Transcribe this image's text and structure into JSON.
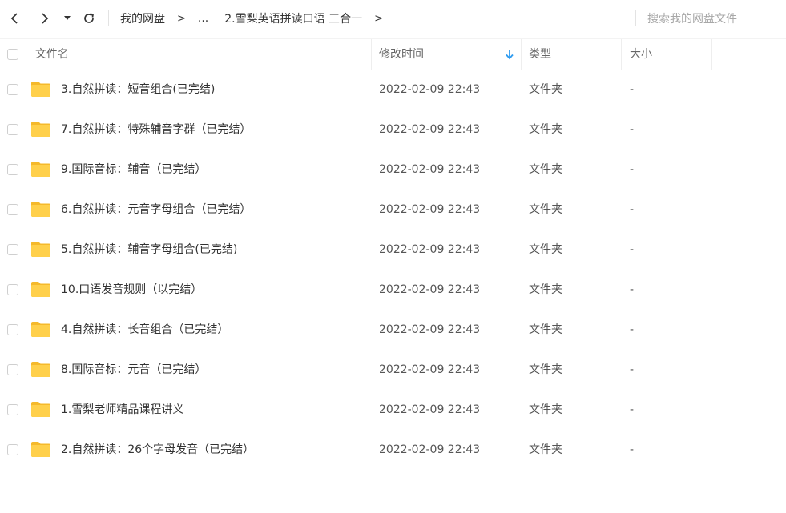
{
  "toolbar": {
    "breadcrumb": [
      {
        "label": "我的网盘"
      },
      {
        "label": "..."
      },
      {
        "label": "2.雪梨英语拼读口语 三合一"
      }
    ],
    "search_placeholder": "搜索我的网盘文件"
  },
  "columns": {
    "name": "文件名",
    "modified": "修改时间",
    "type": "类型",
    "size": "大小"
  },
  "files": [
    {
      "name": "3.自然拼读：短音组合(已完结)",
      "modified": "2022-02-09 22:43",
      "type": "文件夹",
      "size": "-"
    },
    {
      "name": "7.自然拼读：特殊辅音字群（已完结）",
      "modified": "2022-02-09 22:43",
      "type": "文件夹",
      "size": "-"
    },
    {
      "name": "9.国际音标：辅音（已完结）",
      "modified": "2022-02-09 22:43",
      "type": "文件夹",
      "size": "-"
    },
    {
      "name": "6.自然拼读：元音字母组合（已完结）",
      "modified": "2022-02-09 22:43",
      "type": "文件夹",
      "size": "-"
    },
    {
      "name": "5.自然拼读：辅音字母组合(已完结)",
      "modified": "2022-02-09 22:43",
      "type": "文件夹",
      "size": "-"
    },
    {
      "name": "10.口语发音规则（以完结）",
      "modified": "2022-02-09 22:43",
      "type": "文件夹",
      "size": "-"
    },
    {
      "name": "4.自然拼读：长音组合（已完结）",
      "modified": "2022-02-09 22:43",
      "type": "文件夹",
      "size": "-"
    },
    {
      "name": "8.国际音标：元音（已完结）",
      "modified": "2022-02-09 22:43",
      "type": "文件夹",
      "size": "-"
    },
    {
      "name": "1.雪梨老师精品课程讲义",
      "modified": "2022-02-09 22:43",
      "type": "文件夹",
      "size": "-"
    },
    {
      "name": "2.自然拼读：26个字母发音（已完结）",
      "modified": "2022-02-09 22:43",
      "type": "文件夹",
      "size": "-"
    }
  ],
  "colors": {
    "folder": "#ffd04b",
    "folder_dark": "#f5b92b",
    "sort_arrow": "#2e9bf0"
  }
}
